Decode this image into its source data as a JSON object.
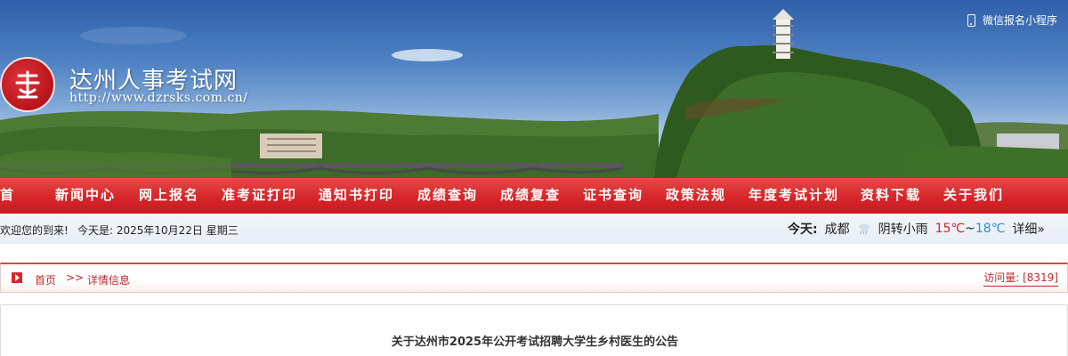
{
  "banner": {
    "site_name": "达州人事考试网",
    "site_url": "http://www.dzrsks.com.cn/",
    "miniprogram_label": "微信报名小程序",
    "logo_icon": "red-seal-logo",
    "phone_icon": "phone-icon"
  },
  "nav": {
    "items": [
      "首",
      "新闻中心",
      "网上报名",
      "准考证打印",
      "通知书打印",
      "成绩查询",
      "成绩复查",
      "证书查询",
      "政策法规",
      "年度考试计划",
      "资料下载",
      "关于我们"
    ]
  },
  "infobar": {
    "welcome": "欢迎您的到来!",
    "date_text": "今天是: 2025年10月22日 星期三",
    "weather": {
      "today_label": "今天:",
      "city": "成都",
      "condition": "阴转小雨",
      "low": "15℃",
      "tilde": "~",
      "high": "18℃",
      "detail": "详细»",
      "icon": "rain-cloud-icon"
    }
  },
  "breadcrumb": {
    "home": "首页",
    "separator": ">>",
    "current": "详情信息",
    "visits": "访问量: [8319]"
  },
  "article": {
    "title": "关于达州市2025年公开考试招聘大学生乡村医生的公告"
  },
  "colors": {
    "nav_red": "#d7262a",
    "breadcrumb_red": "#c0282b",
    "low_temp": "#e02020",
    "high_temp": "#2a8fd6"
  }
}
